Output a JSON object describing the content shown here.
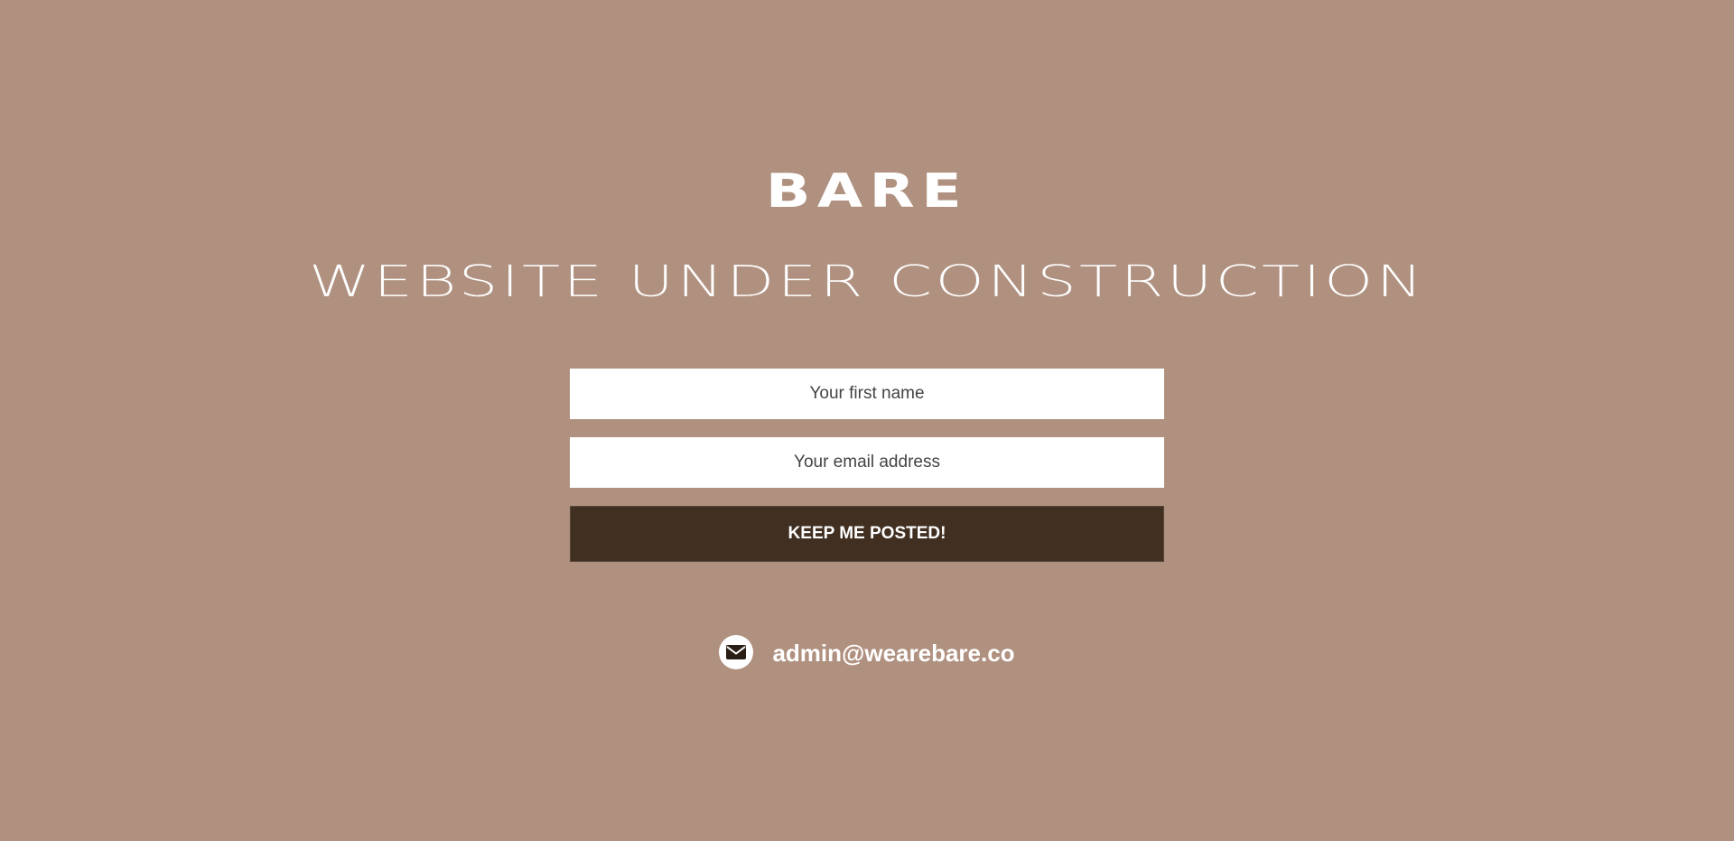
{
  "brand": {
    "name": "BARE"
  },
  "headline": "WEBSITE UNDER CONSTRUCTION",
  "form": {
    "first_name": {
      "placeholder": "Your first name",
      "value": ""
    },
    "email": {
      "placeholder": "Your email address",
      "value": ""
    },
    "submit_label": "KEEP ME POSTED!"
  },
  "contact": {
    "icon": "envelope-icon",
    "email": "admin@wearebare.co"
  },
  "colors": {
    "background": "#b09180",
    "button": "#412f22",
    "text": "#ffffff"
  }
}
